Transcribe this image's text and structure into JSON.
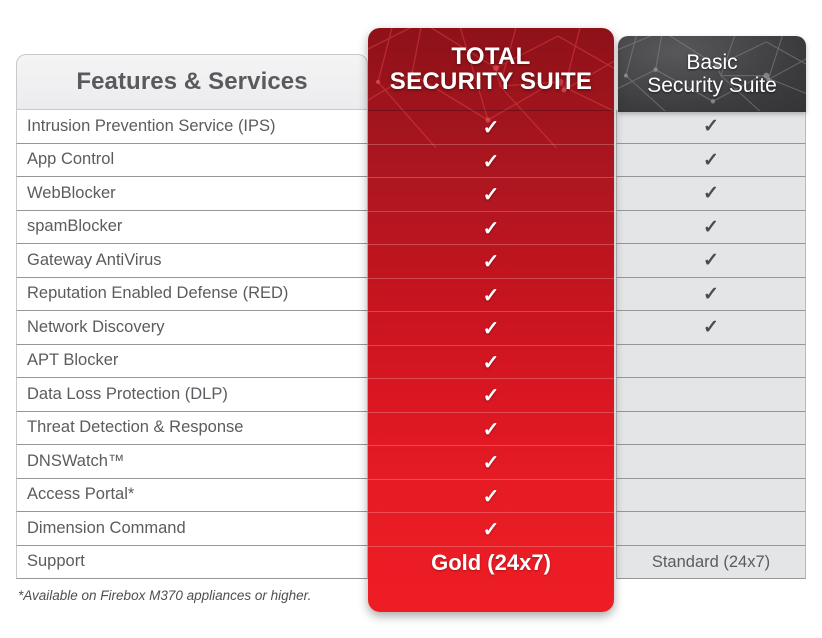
{
  "table": {
    "feature_header": "Features & Services",
    "columns": [
      {
        "id": "total",
        "label_line1": "TOTAL",
        "label_line2": "SECURITY SUITE",
        "accent": "#c3141f"
      },
      {
        "id": "basic",
        "label_line1": "Basic",
        "label_line2": "Security Suite",
        "accent": "#3c3c3f"
      }
    ],
    "check_glyph": "✓",
    "rows": [
      {
        "feature": "Intrusion Prevention Service (IPS)",
        "total": true,
        "basic": true
      },
      {
        "feature": "App Control",
        "total": true,
        "basic": true
      },
      {
        "feature": "WebBlocker",
        "total": true,
        "basic": true
      },
      {
        "feature": "spamBlocker",
        "total": true,
        "basic": true
      },
      {
        "feature": "Gateway AntiVirus",
        "total": true,
        "basic": true
      },
      {
        "feature": "Reputation Enabled Defense (RED)",
        "total": true,
        "basic": true
      },
      {
        "feature": "Network Discovery",
        "total": true,
        "basic": true
      },
      {
        "feature": "APT Blocker",
        "total": true,
        "basic": false
      },
      {
        "feature": "Data Loss Protection (DLP)",
        "total": true,
        "basic": false
      },
      {
        "feature": "Threat Detection & Response",
        "total": true,
        "basic": false
      },
      {
        "feature": "DNSWatch™",
        "total": true,
        "basic": false
      },
      {
        "feature": "Access Portal*",
        "total": true,
        "basic": false
      },
      {
        "feature": "Dimension Command",
        "total": true,
        "basic": false
      }
    ],
    "support_row": {
      "feature": "Support",
      "total": "Gold (24x7)",
      "basic": "Standard (24x7)"
    }
  },
  "footnote": "*Available on Firebox M370 appliances or higher."
}
